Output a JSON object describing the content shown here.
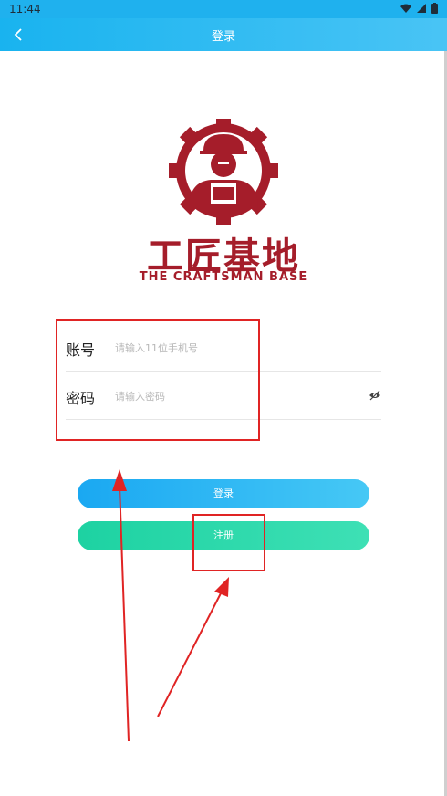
{
  "status_bar": {
    "time": "11:44"
  },
  "app_bar": {
    "title": "登录"
  },
  "logo": {
    "cn_text": "工匠基地",
    "en_text": "THE CRAFTSMAN BASE"
  },
  "form": {
    "account": {
      "label": "账号",
      "placeholder": "请输入11位手机号"
    },
    "password": {
      "label": "密码",
      "placeholder": "请输入密码"
    }
  },
  "buttons": {
    "login": "登录",
    "register": "注册"
  },
  "colors": {
    "app_bar": "#19b3ef",
    "logo": "#a51d2a",
    "annotation": "#e02424",
    "register": "#1dd2a2"
  }
}
